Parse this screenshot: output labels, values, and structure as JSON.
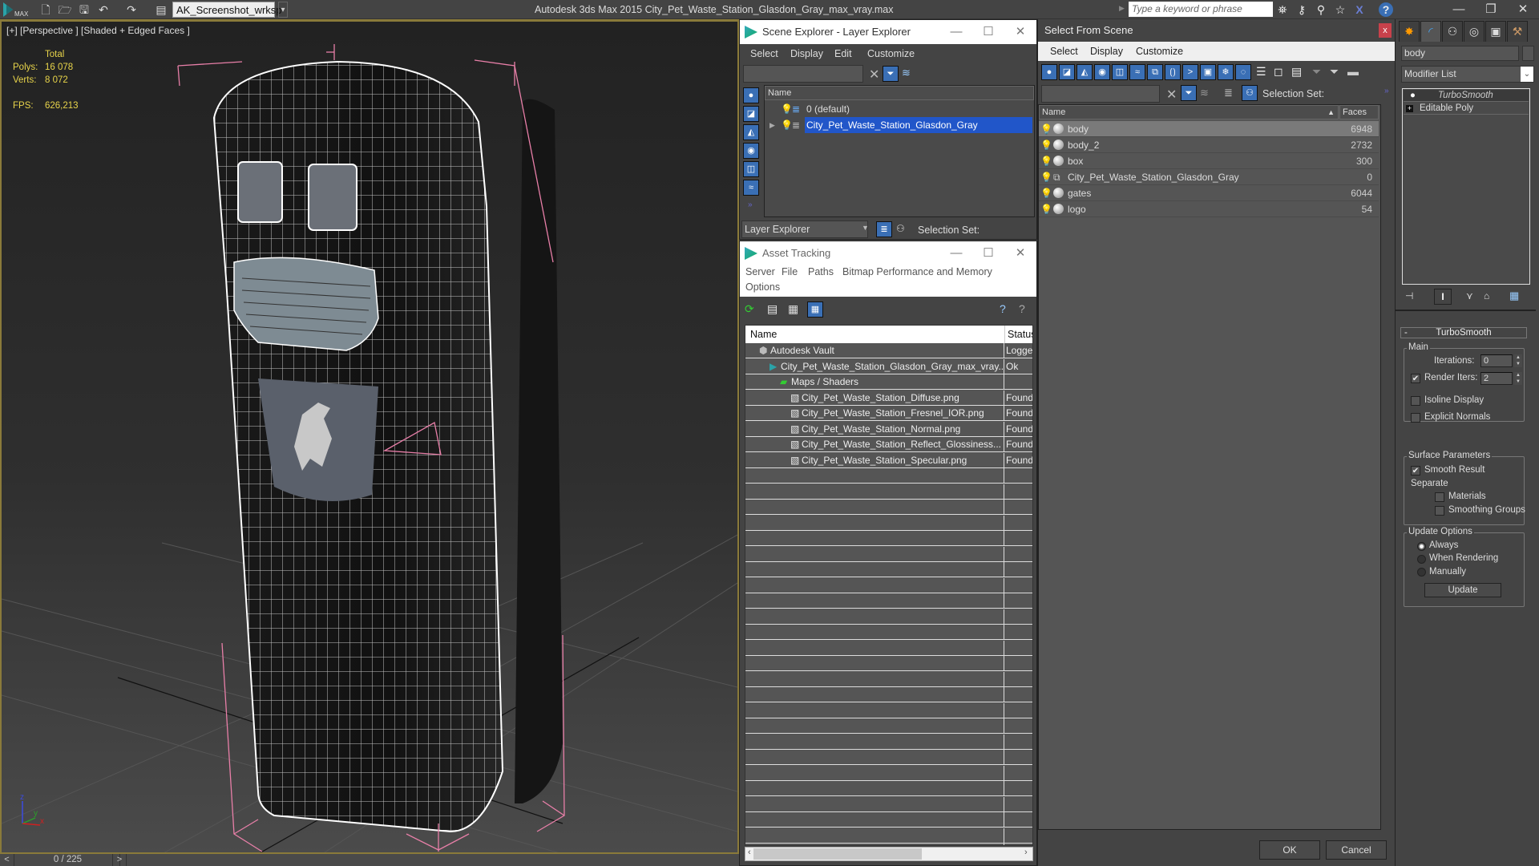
{
  "titlebar": {
    "app_logo": "MAX",
    "workspace": "AK_Screenshot_wrksp",
    "title": "Autodesk 3ds Max  2015    City_Pet_Waste_Station_Glasdon_Gray_max_vray.max",
    "search_placeholder": "Type a keyword or phrase",
    "icons": [
      "new-file-icon",
      "open-icon",
      "save-icon",
      "undo-icon",
      "redo-icon",
      "project-icon"
    ],
    "tool_icons": [
      "binoculars-icon",
      "key-icon",
      "satellite-icon",
      "star-icon",
      "x-icon",
      "help-icon"
    ]
  },
  "viewport": {
    "label": "[+] [Perspective ] [Shaded + Edged Faces ]",
    "stats": {
      "total_label": "Total",
      "polys_label": "Polys:",
      "polys_value": "16 078",
      "verts_label": "Verts:",
      "verts_value": "8 072",
      "fps_label": "FPS:",
      "fps_value": "626,213"
    },
    "axis": {
      "x": "x",
      "y": "y",
      "z": "z"
    }
  },
  "timeline": {
    "prev": "<",
    "frame": "0 / 225",
    "next": ">"
  },
  "scene_explorer": {
    "title": "Scene Explorer - Layer Explorer",
    "menus": [
      "Select",
      "Display",
      "Edit",
      "Customize"
    ],
    "column_name": "Name",
    "rows": [
      {
        "label": "0 (default)",
        "selected": false
      },
      {
        "label": "City_Pet_Waste_Station_Glasdon_Gray",
        "selected": true
      }
    ],
    "footer_mode": "Layer Explorer",
    "selection_set_label": "Selection Set:"
  },
  "asset_tracking": {
    "title": "Asset Tracking",
    "menus": [
      "Server",
      "File",
      "Paths",
      "Bitmap Performance and Memory",
      "Options"
    ],
    "columns": [
      "Name",
      "Status"
    ],
    "rows": [
      {
        "name": "Autodesk Vault",
        "status": "Logged",
        "indent": 1,
        "icon": "vault-icon"
      },
      {
        "name": "City_Pet_Waste_Station_Glasdon_Gray_max_vray...",
        "status": "Ok",
        "indent": 2,
        "icon": "max-file-icon"
      },
      {
        "name": "Maps / Shaders",
        "status": "",
        "indent": 3,
        "icon": "maps-icon"
      },
      {
        "name": "City_Pet_Waste_Station_Diffuse.png",
        "status": "Found",
        "indent": 4,
        "icon": "image-file-icon"
      },
      {
        "name": "City_Pet_Waste_Station_Fresnel_IOR.png",
        "status": "Found",
        "indent": 4,
        "icon": "image-file-icon"
      },
      {
        "name": "City_Pet_Waste_Station_Normal.png",
        "status": "Found",
        "indent": 4,
        "icon": "image-file-icon"
      },
      {
        "name": "City_Pet_Waste_Station_Reflect_Glossiness...",
        "status": "Found",
        "indent": 4,
        "icon": "image-file-icon"
      },
      {
        "name": "City_Pet_Waste_Station_Specular.png",
        "status": "Found",
        "indent": 4,
        "icon": "image-file-icon"
      }
    ]
  },
  "select_from_scene": {
    "title": "Select From Scene",
    "menus": [
      "Select",
      "Display",
      "Customize"
    ],
    "selection_set_label": "Selection Set:",
    "columns": [
      "Name",
      "Faces"
    ],
    "rows": [
      {
        "name": "body",
        "faces": "6948",
        "selected": true,
        "type": "geometry"
      },
      {
        "name": "body_2",
        "faces": "2732",
        "selected": false,
        "type": "geometry"
      },
      {
        "name": "box",
        "faces": "300",
        "selected": false,
        "type": "geometry"
      },
      {
        "name": "City_Pet_Waste_Station_Glasdon_Gray",
        "faces": "0",
        "selected": false,
        "type": "group"
      },
      {
        "name": "gates",
        "faces": "6044",
        "selected": false,
        "type": "geometry"
      },
      {
        "name": "logo",
        "faces": "54",
        "selected": false,
        "type": "geometry"
      }
    ],
    "ok_label": "OK",
    "cancel_label": "Cancel"
  },
  "command_panel": {
    "object_name": "body",
    "modifier_list_label": "Modifier List",
    "stack": [
      {
        "label": "TurboSmooth",
        "active": true
      },
      {
        "label": "Editable Poly",
        "active": false
      }
    ],
    "rollout_title": "TurboSmooth",
    "main_group": "Main",
    "iterations_label": "Iterations:",
    "iterations_value": "0",
    "render_iters_label": "Render Iters:",
    "render_iters_value": "2",
    "render_iters_checked": true,
    "isoline_label": "Isoline Display",
    "isoline_checked": false,
    "explicit_normals_label": "Explicit Normals",
    "explicit_normals_checked": false,
    "surface_group": "Surface Parameters",
    "smooth_result_label": "Smooth Result",
    "smooth_result_checked": true,
    "separate_label": "Separate",
    "materials_label": "Materials",
    "materials_checked": false,
    "smoothing_groups_label": "Smoothing Groups",
    "smoothing_groups_checked": false,
    "update_group": "Update Options",
    "update_options": [
      "Always",
      "When Rendering",
      "Manually"
    ],
    "update_selected": "Always",
    "update_button": "Update"
  }
}
